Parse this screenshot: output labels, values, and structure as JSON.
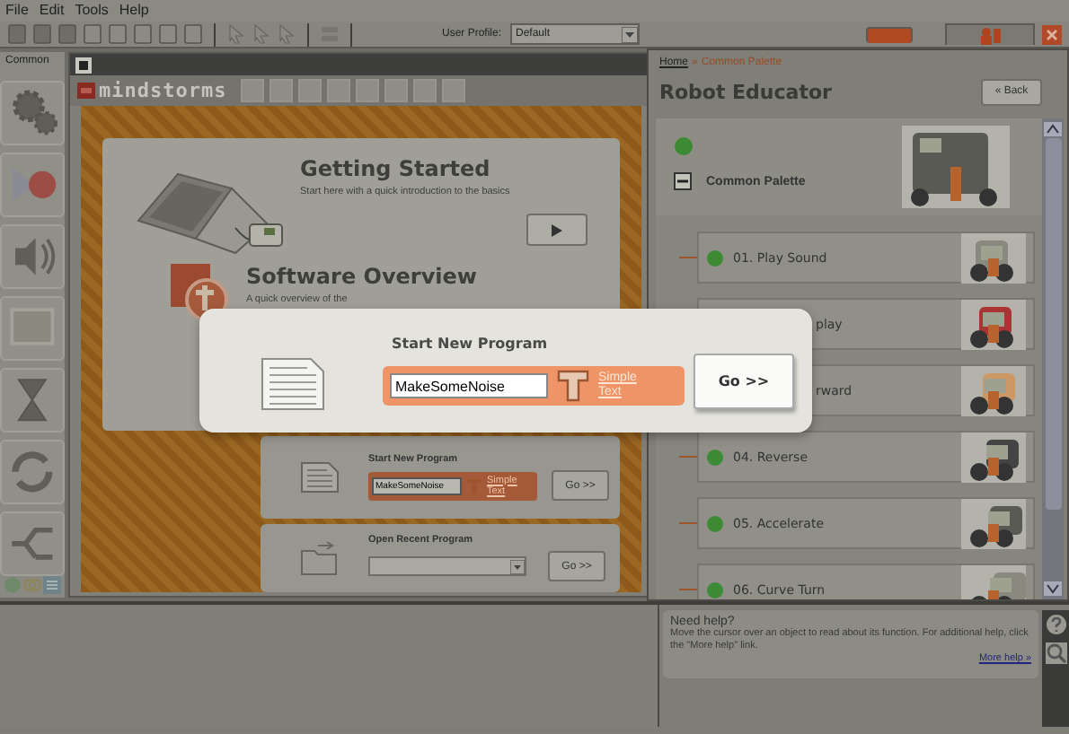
{
  "menu": [
    "File",
    "Edit",
    "Tools",
    "Help"
  ],
  "toolbar": {
    "profile_label": "User Profile:",
    "profile_value": "Default"
  },
  "palette": {
    "title": "Common"
  },
  "canvas": {
    "logo": "mindstorms",
    "getting_started": {
      "title": "Getting Started",
      "text": "Start here with a quick introduction to the basics"
    },
    "software_overview": {
      "title": "Software Overview",
      "text": "A quick overview of the"
    },
    "start_program": {
      "title": "Start New Program",
      "value": "MakeSomeNoise",
      "link": "Simple Text",
      "button": "Go >>"
    },
    "open_recent": {
      "title": "Open Recent Program",
      "button": "Go >>"
    }
  },
  "educator": {
    "home": "Home",
    "separator": "»",
    "current": "Common Palette",
    "title": "Robot Educator",
    "back": "« Back",
    "section": {
      "label": "Common Palette",
      "expanded": true
    },
    "lessons": [
      {
        "label": "01. Play Sound"
      },
      {
        "label": "play"
      },
      {
        "label": "rward"
      },
      {
        "label": "04. Reverse"
      },
      {
        "label": "05. Accelerate"
      },
      {
        "label": "06. Curve Turn"
      }
    ]
  },
  "help": {
    "title": "Need help?",
    "text": "Move the cursor over an object to read about its function. For additional help, click the \"More help\" link.",
    "link": "More help »"
  },
  "dialog": {
    "title": "Start New Program",
    "value": "MakeSomeNoise",
    "link": "Simple Text",
    "button": "Go >>"
  }
}
